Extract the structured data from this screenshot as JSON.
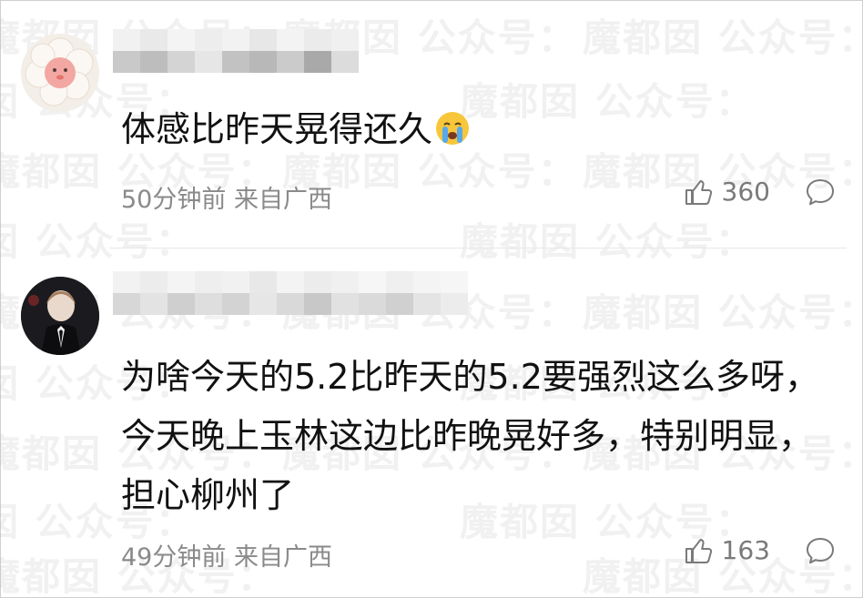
{
  "watermark": "魔都囡 公众号：",
  "comments": [
    {
      "text": "体感比昨天晃得还久",
      "emoji": "crying-face",
      "time_location": "50分钟前 来自广西",
      "likes": "360"
    },
    {
      "text": "为啥今天的5.2比昨天的5.2要强烈这么多呀，今天晚上玉林这边比昨晚晃好多，特别明显，担心柳州了",
      "time_location": "49分钟前 来自广西",
      "likes": "163"
    }
  ],
  "colors": {
    "text": "#111111",
    "meta": "#8a8a8a",
    "watermark": "#bebebe"
  }
}
